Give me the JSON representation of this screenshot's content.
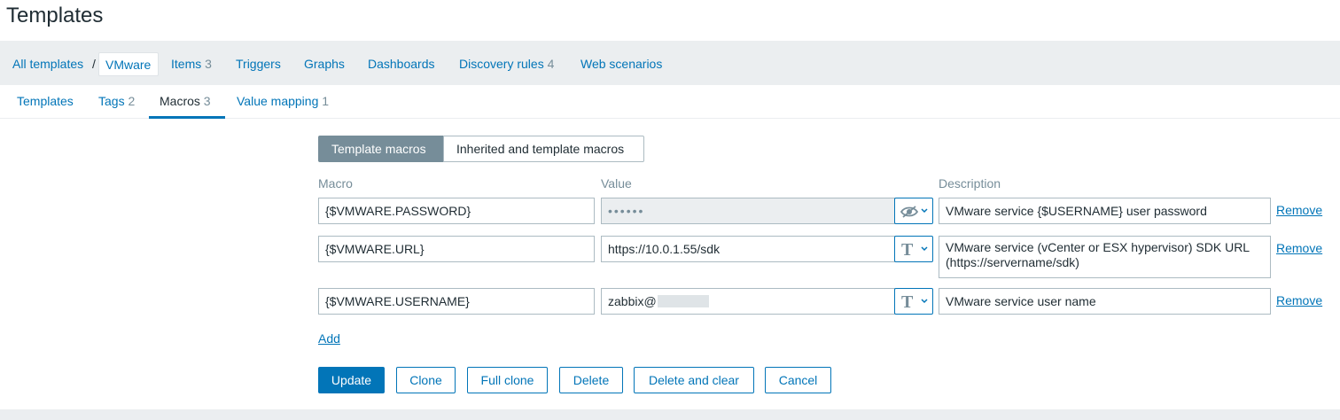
{
  "header": {
    "title": "Templates"
  },
  "nav": {
    "all_templates": "All templates",
    "separator": "/",
    "current": "VMware",
    "items": {
      "label": "Items",
      "count": "3"
    },
    "triggers": {
      "label": "Triggers"
    },
    "graphs": {
      "label": "Graphs"
    },
    "dashboards": {
      "label": "Dashboards"
    },
    "discovery": {
      "label": "Discovery rules",
      "count": "4"
    },
    "web": {
      "label": "Web scenarios"
    }
  },
  "tabs": {
    "templates": {
      "label": "Templates"
    },
    "tags": {
      "label": "Tags",
      "count": "2"
    },
    "macros": {
      "label": "Macros",
      "count": "3"
    },
    "value_mapping": {
      "label": "Value mapping",
      "count": "1"
    }
  },
  "macro_view": {
    "template_macros": "Template macros",
    "inherited_macros": "Inherited and template macros"
  },
  "columns": {
    "macro": "Macro",
    "value": "Value",
    "description": "Description"
  },
  "macros": {
    "r0": {
      "macro": "{$VMWARE.PASSWORD}",
      "value_masked": "••••••",
      "type_icon": "eye-slash-icon",
      "description": "VMware service {$USERNAME} user password",
      "remove": "Remove"
    },
    "r1": {
      "macro": "{$VMWARE.URL}",
      "value": "https://10.0.1.55/sdk",
      "type_icon": "text-type-icon",
      "type_glyph": "T",
      "description": "VMware service (vCenter or ESX hypervisor) SDK URL (https://servername/sdk)",
      "remove": "Remove"
    },
    "r2": {
      "macro": "{$VMWARE.USERNAME}",
      "value": "zabbix@",
      "type_icon": "text-type-icon",
      "type_glyph": "T",
      "description": "VMware service user name",
      "remove": "Remove"
    }
  },
  "add_label": "Add",
  "buttons": {
    "update": "Update",
    "clone": "Clone",
    "full_clone": "Full clone",
    "delete": "Delete",
    "delete_clear": "Delete and clear",
    "cancel": "Cancel"
  },
  "colors": {
    "accent": "#0275b8",
    "muted": "#768d99",
    "background": "#ebeef0"
  }
}
